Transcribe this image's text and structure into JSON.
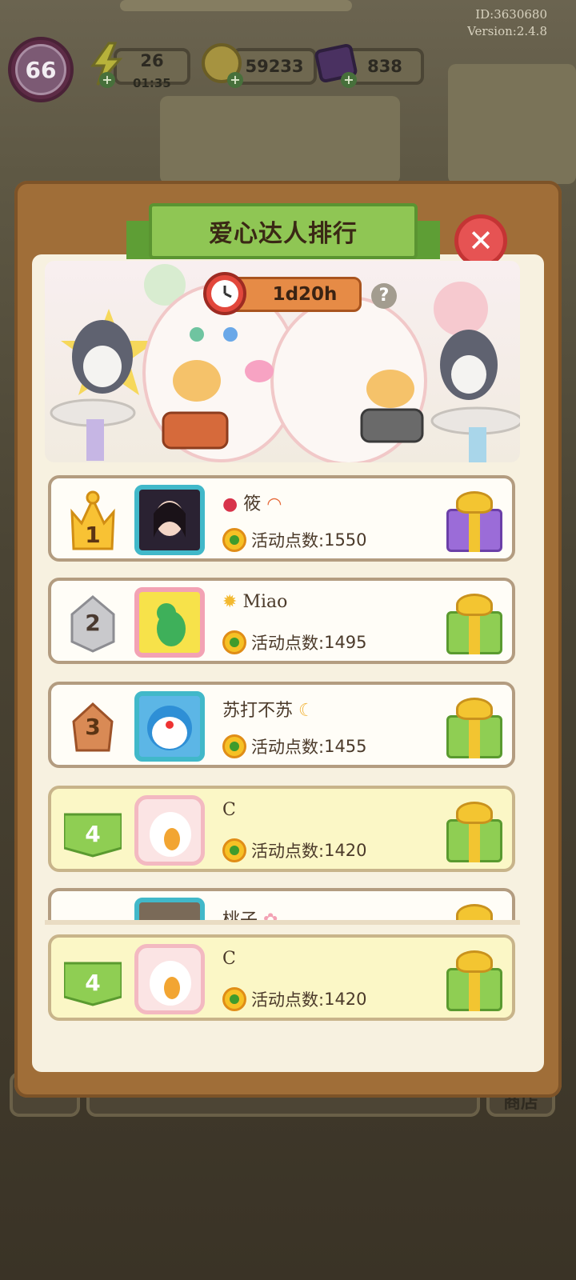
{
  "game_info": {
    "id": "ID:3630680",
    "version": "Version:2.4.8"
  },
  "status": {
    "level": "66",
    "energy": "26",
    "energy_timer": "01:35",
    "coins": "59233",
    "gems": "838"
  },
  "leaderboard": {
    "title": "爱心达人排行",
    "time_left": "1d20h",
    "help": "?",
    "close": "✕",
    "rows": [
      {
        "rank": "1",
        "name": "筱",
        "score_label": "活动点数:",
        "score": "1550",
        "gift": "purple"
      },
      {
        "rank": "2",
        "name": "Miao",
        "score_label": "活动点数:",
        "score": "1495",
        "gift": "green"
      },
      {
        "rank": "3",
        "name": "苏打不苏",
        "score_label": "活动点数:",
        "score": "1455",
        "gift": "green"
      },
      {
        "rank": "4",
        "name": "C",
        "score_label": "活动点数:",
        "score": "1420",
        "gift": "green"
      },
      {
        "rank": "",
        "name": "桃子",
        "score_label": "",
        "score": "",
        "gift": "green"
      }
    ],
    "my_row": {
      "rank": "4",
      "name": "C",
      "score_label": "活动点数:",
      "score": "1420",
      "gift": "green"
    }
  },
  "bottom": {
    "shop": "商店"
  },
  "colors": {
    "panel": "#a06e38",
    "paper": "#f7f1e0",
    "ribbon": "#8fc654",
    "close": "#e65353",
    "highlight": "#fbf7c6"
  }
}
